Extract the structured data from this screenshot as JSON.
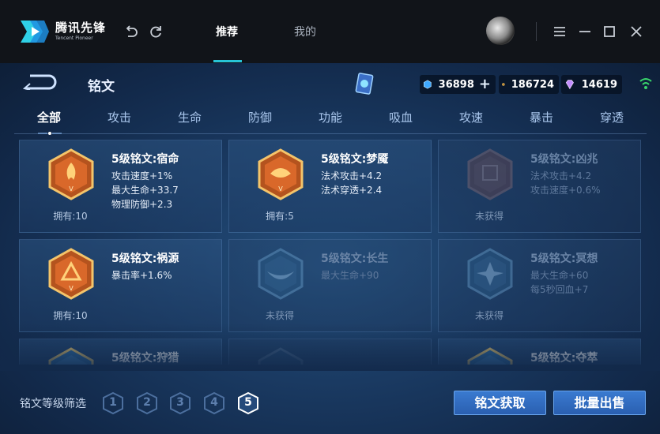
{
  "app": {
    "logo_text": "腾讯先锋",
    "logo_sub": "Tencent Pioneer",
    "tabs": [
      {
        "label": "推荐",
        "active": true
      },
      {
        "label": "我的",
        "active": false
      }
    ],
    "icons": [
      "undo-icon",
      "refresh-icon",
      "menu-icon",
      "minimize-icon",
      "maximize-icon",
      "close-icon"
    ],
    "accent": "#27c4d6"
  },
  "game": {
    "title": "铭文",
    "currencies": [
      {
        "icon": "diamond-icon",
        "value": "36898",
        "has_plus": true
      },
      {
        "icon": "gold-coin-icon",
        "value": "186724",
        "has_plus": false
      },
      {
        "icon": "gem-icon",
        "value": "14619",
        "has_plus": false
      }
    ],
    "categories": [
      "全部",
      "攻击",
      "生命",
      "防御",
      "功能",
      "吸血",
      "攻速",
      "暴击",
      "穿透"
    ],
    "active_category": "全部",
    "runes": [
      {
        "name": "5级铭文:宿命",
        "attrs": [
          "攻击速度+1%",
          "最大生命+33.7",
          "物理防御+2.3"
        ],
        "owned": "拥有:10",
        "locked": false,
        "color": "red"
      },
      {
        "name": "5级铭文:梦魇",
        "attrs": [
          "法术攻击+4.2",
          "法术穿透+2.4"
        ],
        "owned": "拥有:5",
        "locked": false,
        "color": "red"
      },
      {
        "name": "5级铭文:凶兆",
        "attrs": [
          "法术攻击+4.2",
          "攻击速度+0.6%"
        ],
        "owned": "未获得",
        "locked": true,
        "color": "red"
      },
      {
        "name": "5级铭文:祸源",
        "attrs": [
          "暴击率+1.6%"
        ],
        "owned": "拥有:10",
        "locked": false,
        "color": "red"
      },
      {
        "name": "5级铭文:长生",
        "attrs": [
          "最大生命+90"
        ],
        "owned": "未获得",
        "locked": true,
        "color": "blue"
      },
      {
        "name": "5级铭文:冥想",
        "attrs": [
          "最大生命+60",
          "每5秒回血+7"
        ],
        "owned": "未获得",
        "locked": true,
        "color": "blue"
      },
      {
        "name": "5级铭文:狩猎",
        "attrs": [],
        "owned": "",
        "locked": false,
        "color": "yellow"
      },
      {
        "name": "",
        "attrs": [],
        "owned": "",
        "locked": true,
        "color": "yellow"
      },
      {
        "name": "5级铭文:夺萃",
        "attrs": [],
        "owned": "",
        "locked": false,
        "color": "yellow"
      }
    ],
    "filter_label": "铭文等级筛选",
    "levels": [
      "1",
      "2",
      "3",
      "4",
      "5"
    ],
    "active_level": "5",
    "buttons": {
      "obtain": "铭文获取",
      "bulk_sell": "批量出售"
    }
  }
}
